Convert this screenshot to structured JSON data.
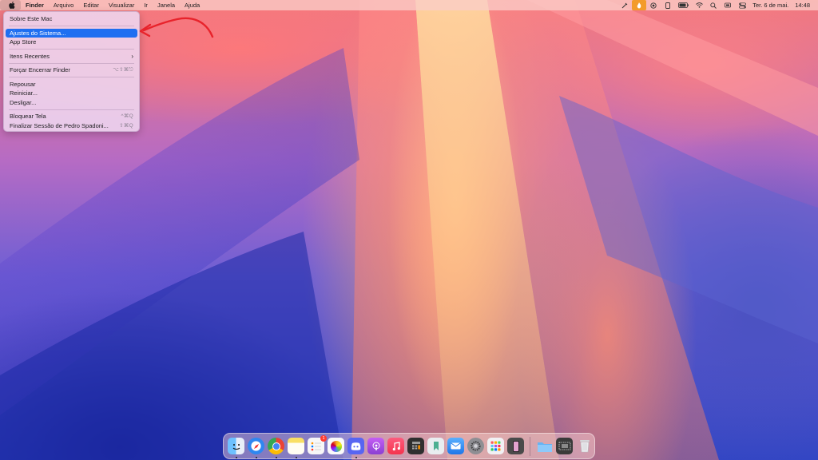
{
  "menubar": {
    "app_name": "Finder",
    "menus": [
      "Arquivo",
      "Editar",
      "Visualizar",
      "Ir",
      "Janela",
      "Ajuda"
    ],
    "date": "Ter. 6 de mai.",
    "time": "14:48"
  },
  "apple_menu": {
    "about": "Sobre Este Mac",
    "settings": "Ajustes do Sistema...",
    "app_store": "App Store",
    "recent": "Itens Recentes",
    "force_quit": "Forçar Encerrar Finder",
    "force_quit_shortcut": "⌥⇧⌘⎋",
    "sleep": "Repousar",
    "restart": "Reiniciar...",
    "shutdown": "Desligar...",
    "lock": "Bloquear Tela",
    "lock_shortcut": "^⌘Q",
    "logout": "Finalizar Sessão de Pedro Spadoni...",
    "logout_shortcut": "⇧⌘Q"
  },
  "dock": {
    "apps": [
      {
        "name": "Finder",
        "icon": "finder-icon",
        "color": "#3b8ff2",
        "running": true
      },
      {
        "name": "Safari",
        "icon": "safari-icon",
        "color": "#2f87f0",
        "running": true
      },
      {
        "name": "Chrome",
        "icon": "chrome-icon",
        "color": "#f2f2f2",
        "running": true
      },
      {
        "name": "Notes",
        "icon": "notes-icon",
        "color": "#f9df63",
        "running": true
      },
      {
        "name": "Reminders",
        "icon": "reminders-icon",
        "color": "#f4f4f4",
        "running": false,
        "badge": "1"
      },
      {
        "name": "Photos",
        "icon": "photos-icon",
        "color": "#f6f6f6",
        "running": false
      },
      {
        "name": "Discord",
        "icon": "discord-icon",
        "color": "#5865f2",
        "running": true
      },
      {
        "name": "Podcasts",
        "icon": "podcasts-icon",
        "color": "#9c4be0",
        "running": false
      },
      {
        "name": "Music",
        "icon": "music-icon",
        "color": "#fa3d55",
        "running": false
      },
      {
        "name": "Calculator",
        "icon": "calculator-icon",
        "color": "#d9d9d9",
        "running": false
      },
      {
        "name": "Notion",
        "icon": "app-icon",
        "color": "#e8e8e8",
        "running": false
      },
      {
        "name": "Mail",
        "icon": "mail-icon",
        "color": "#2f8cf2",
        "running": false
      },
      {
        "name": "System Settings",
        "icon": "gear-icon",
        "color": "#8e8e93",
        "running": false
      },
      {
        "name": "Launchpad",
        "icon": "launchpad-icon",
        "color": "#f2f2f2",
        "running": false
      },
      {
        "name": "iPhone Mirroring",
        "icon": "iphone-icon",
        "color": "#4a4a4a",
        "running": false
      }
    ],
    "extras": [
      {
        "name": "Downloads",
        "icon": "folder-icon",
        "color": "#67b3f3"
      },
      {
        "name": "Screenshot",
        "icon": "screenshot-icon",
        "color": "#3a3a3a"
      },
      {
        "name": "Trash",
        "icon": "trash-icon",
        "color": "#e7e7ea"
      }
    ]
  }
}
